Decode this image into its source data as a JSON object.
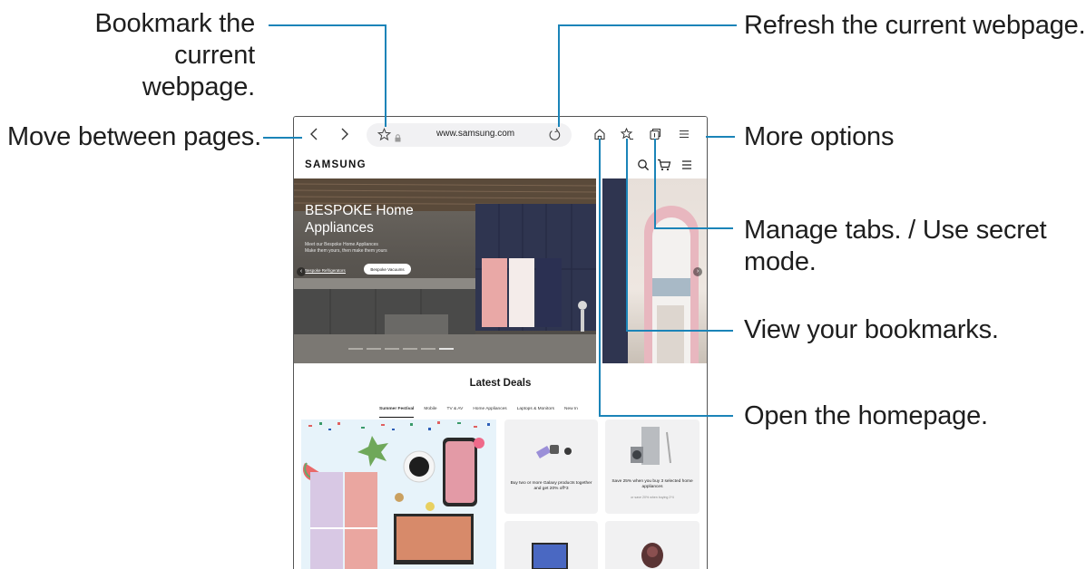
{
  "callouts": {
    "bookmark_line1": "Bookmark the current",
    "bookmark_line2": "webpage.",
    "move_pages": "Move between pages.",
    "refresh": "Refresh the current webpage.",
    "more_options": "More options",
    "manage_tabs_line1": "Manage tabs. / Use secret",
    "manage_tabs_line2": "mode.",
    "view_bookmarks": "View your bookmarks.",
    "open_homepage": "Open the homepage."
  },
  "browser": {
    "url": "www.samsung.com",
    "icons": {
      "back": "chevron-left-icon",
      "forward": "chevron-right-icon",
      "bookmark_add": "star-outline-icon",
      "lock": "lock-icon",
      "refresh": "refresh-icon",
      "home": "home-icon",
      "bookmarks": "star-list-icon",
      "tabs": "tabs-icon",
      "menu": "menu-icon"
    }
  },
  "site": {
    "brand": "SAMSUNG",
    "header_icons": [
      "search-icon",
      "cart-icon",
      "menu-icon"
    ],
    "hero": {
      "title_line1": "BESPOKE Home",
      "title_line2": "Appliances",
      "subtitle_line1": "Meet our Bespoke Home Appliances",
      "subtitle_line2": "Make them yours, then make them yours",
      "link": "Bespoke Refrigerators",
      "button": "Bespoke Vacuums"
    },
    "latest_deals": {
      "title": "Latest Deals",
      "tabs": [
        "Summer Festival",
        "Mobile",
        "TV & AV",
        "Home Appliances",
        "Laptops & Monitors",
        "New In"
      ],
      "active_tab": "Summer Festival",
      "cards": [
        {
          "text": "Buy two or more Galaxy products together and get 20% off*3",
          "fine": ""
        },
        {
          "text": "Save 25% when you buy 3 selected home appliances",
          "fine": "or save 20% when buying 2*4"
        }
      ]
    }
  },
  "colors": {
    "leader_line": "#1b84b8",
    "accent_pink": "#e9a4a4",
    "cabinet_navy": "#2e3354"
  }
}
